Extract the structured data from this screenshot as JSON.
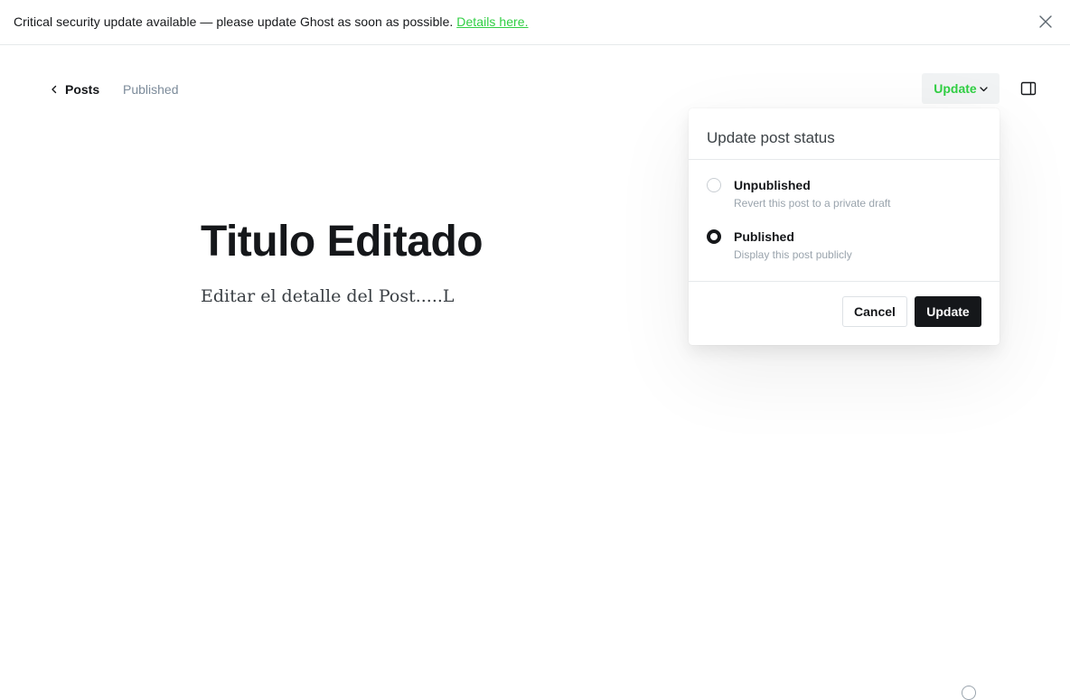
{
  "banner": {
    "message": "Critical security update available — please update Ghost as soon as possible.",
    "link_label": "Details here."
  },
  "header": {
    "back_label": "Posts",
    "status": "Published",
    "update_label": "Update"
  },
  "post": {
    "title": "Titulo Editado",
    "body": "Editar el detalle del Post.....L"
  },
  "popup": {
    "title": "Update post status",
    "options": [
      {
        "label": "Unpublished",
        "description": "Revert this post to a private draft",
        "selected": false
      },
      {
        "label": "Published",
        "description": "Display this post publicly",
        "selected": true
      }
    ],
    "cancel_label": "Cancel",
    "update_label": "Update"
  },
  "colors": {
    "accent": "#30cf43",
    "text": "#15171a",
    "muted": "#7c8b9a",
    "button_dark": "#15171a"
  },
  "icons": {
    "close": "close-icon",
    "back": "chevron-left-icon",
    "dropdown": "chevron-down-icon",
    "sidebar": "sidebar-toggle-icon",
    "help": "help-icon"
  }
}
